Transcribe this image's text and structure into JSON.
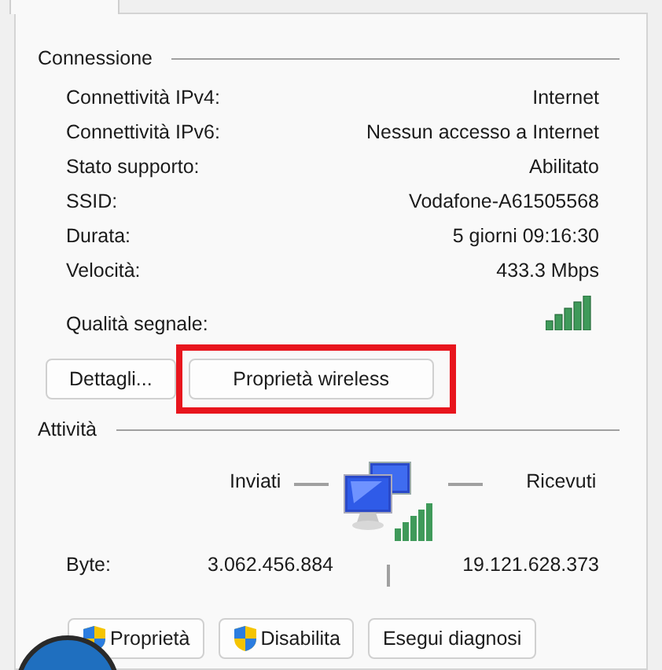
{
  "connection": {
    "title": "Connessione",
    "rows": [
      {
        "label": "Connettività IPv4:",
        "value": "Internet"
      },
      {
        "label": "Connettività IPv6:",
        "value": "Nessun accesso a Internet"
      },
      {
        "label": "Stato supporto:",
        "value": "Abilitato"
      },
      {
        "label": "SSID:",
        "value": "Vodafone-A61505568"
      },
      {
        "label": "Durata:",
        "value": "5 giorni 09:16:30"
      },
      {
        "label": "Velocità:",
        "value": "433.3 Mbps"
      }
    ],
    "signal_label": "Qualità segnale:",
    "buttons": [
      {
        "label": "Dettagli...",
        "highlighted": false
      },
      {
        "label": "Proprietà wireless",
        "highlighted": true
      }
    ]
  },
  "activity": {
    "title": "Attività",
    "sent_label": "Inviati",
    "received_label": "Ricevuti",
    "bytes_label": "Byte:",
    "sent": "3.062.456.884",
    "received": "19.121.628.373"
  },
  "buttons": [
    {
      "label": "Proprietà",
      "shield": true
    },
    {
      "label": "Disabilita",
      "shield": true
    },
    {
      "label": "Esegui diagnosi",
      "shield": false
    }
  ]
}
